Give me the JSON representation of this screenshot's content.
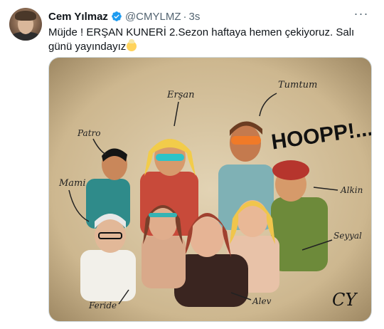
{
  "tweet": {
    "author_name": "Cem Yılmaz",
    "author_handle": "@CMYLMZ",
    "separator": "·",
    "timestamp": "3s",
    "more_label": "···",
    "text": "Müjde ! ERŞAN KUNERİ 2.Sezon haftaya hemen çekiyoruz. Salı günü yayındayız",
    "emoji": "baby-emoji"
  },
  "media": {
    "description_icon": "illustration-image",
    "speech_text": "HOOPP!...",
    "character_labels": [
      "Erşan",
      "Tumtum",
      "Patro",
      "Mami",
      "Alkin",
      "Seyyal",
      "Feride",
      "Alev"
    ],
    "signature": "CY"
  },
  "colors": {
    "verified": "#1d9bf0",
    "muted": "#536471",
    "paper": "#cdb78f"
  }
}
